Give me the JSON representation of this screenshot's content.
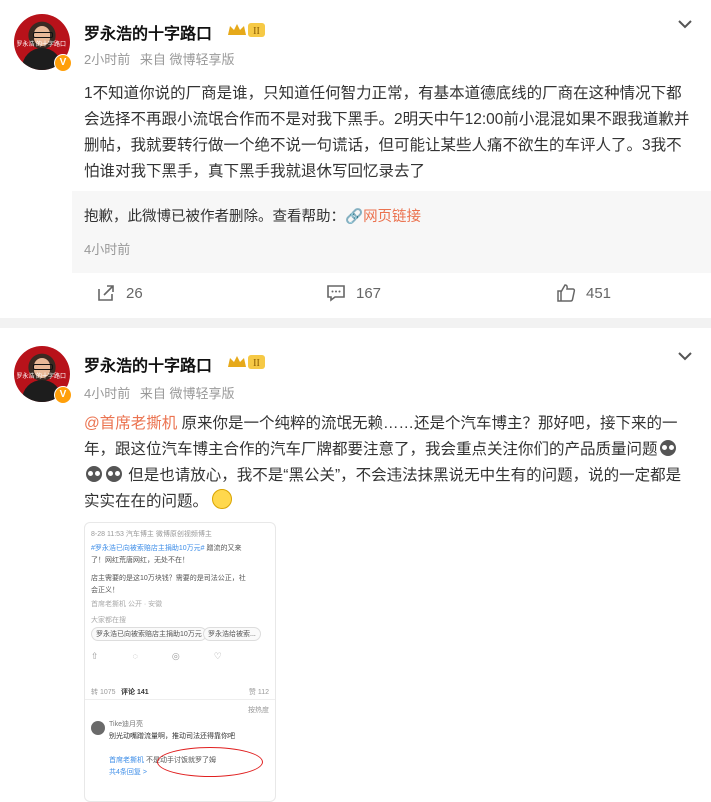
{
  "posts": [
    {
      "author": "罗永浩的十字路口",
      "level_badge": "II",
      "verified_badge": "V",
      "avatar_caption": "罗永浩 的十字路口",
      "time": "2小时前",
      "source": "来自 微博轻享版",
      "text": "1不知道你说的厂商是谁，只知道任何智力正常，有基本道德底线的厂商在这种情况下都会选择不再跟小流氓合作而不是对我下黑手。2明天中午12:00前小混混如果不跟我道歉并删帖，我就要转行做一个绝不说一句谎话，但可能让某些人痛不欲生的车评人了。3我不怕谁对我下黑手，真下黑手我就退休写回忆录去了",
      "repost": {
        "deleted_message": "抱歉，此微博已被作者删除。查看帮助：",
        "help_link": "网页链接",
        "time": "4小时前"
      },
      "actions": {
        "share": "26",
        "comment": "167",
        "like": "451"
      }
    },
    {
      "author": "罗永浩的十字路口",
      "level_badge": "II",
      "verified_badge": "V",
      "avatar_caption": "罗永浩 的十字路口",
      "time": "4小时前",
      "source": "来自 微博轻享版",
      "mention": "@首席老撕机",
      "text_part1": " 原来你是一个纯粹的流氓无赖……还是个汽车博主？那好吧，接下来的一年，跟这位汽车博主合作的汽车厂牌都要注意了，我会重点关注你们的产品质量问题",
      "text_part2": " 但是也请放心，我不是“黑公关”，不会违法抹黑说无中生有的问题，说的一定都是实实在在的问题。",
      "screenshot": {
        "header_time": "8-28 11:53  汽车博主 微博原创视频博主",
        "hashtag": "#罗永浩已向被索赔店主捐助10万元#",
        "line1_rest": " 蹭流的又来",
        "line2": "了！网红荒唐网红，无处不在！",
        "line3": "店主需要的是这10万块钱？需要的是司法公正，社",
        "line4": "会正义！",
        "small_meta": "首席老撕机                          公开 · 安徽",
        "topic_label": "大家都在搜",
        "chip1": "罗永浩已向被索赔店主捐助10万元",
        "chip2": "罗永浩给被索...",
        "tab_repost": "转 1075",
        "tab_comment": "评论 141",
        "tab_like": "赞 112",
        "sort_label": "按热度",
        "commenter": "Tike迪月亮",
        "comment_text": "别光动嘴蹭流量啊，推动司法还得靠你吧",
        "reply_author": "首席老撕机",
        "reply_text": "不是动手讨饭就罗了姆",
        "more_replies": "共4条回复 >"
      },
      "actions": {}
    }
  ],
  "colors": {
    "accent": "#eb7350",
    "muted": "#999999",
    "text": "#333333"
  }
}
